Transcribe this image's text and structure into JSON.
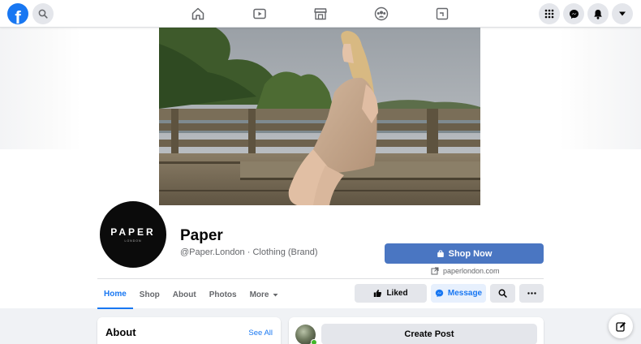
{
  "topbar": {
    "logo_letter": "f",
    "nav_icons": [
      "home-icon",
      "watch-icon",
      "marketplace-icon",
      "groups-icon",
      "gaming-icon"
    ],
    "right_icons": [
      "apps-grid-icon",
      "messenger-icon",
      "notifications-icon",
      "account-menu-icon"
    ]
  },
  "profile": {
    "avatar_brand": "PAPER",
    "avatar_sub": "LONDON",
    "name": "Paper",
    "subtitle": "@Paper.London · Clothing (Brand)"
  },
  "actions": {
    "shop_now": "Shop Now",
    "website": "paperlondon.com",
    "liked": "Liked",
    "message": "Message"
  },
  "tabs": [
    {
      "label": "Home"
    },
    {
      "label": "Shop"
    },
    {
      "label": "About"
    },
    {
      "label": "Photos"
    },
    {
      "label": "More"
    }
  ],
  "about_card": {
    "title": "About",
    "see_all": "See All"
  },
  "post_card": {
    "create_post": "Create Post"
  },
  "colors": {
    "brand_blue": "#1877f2",
    "shop_button": "#4a76c2",
    "online_green": "#42b72a"
  }
}
